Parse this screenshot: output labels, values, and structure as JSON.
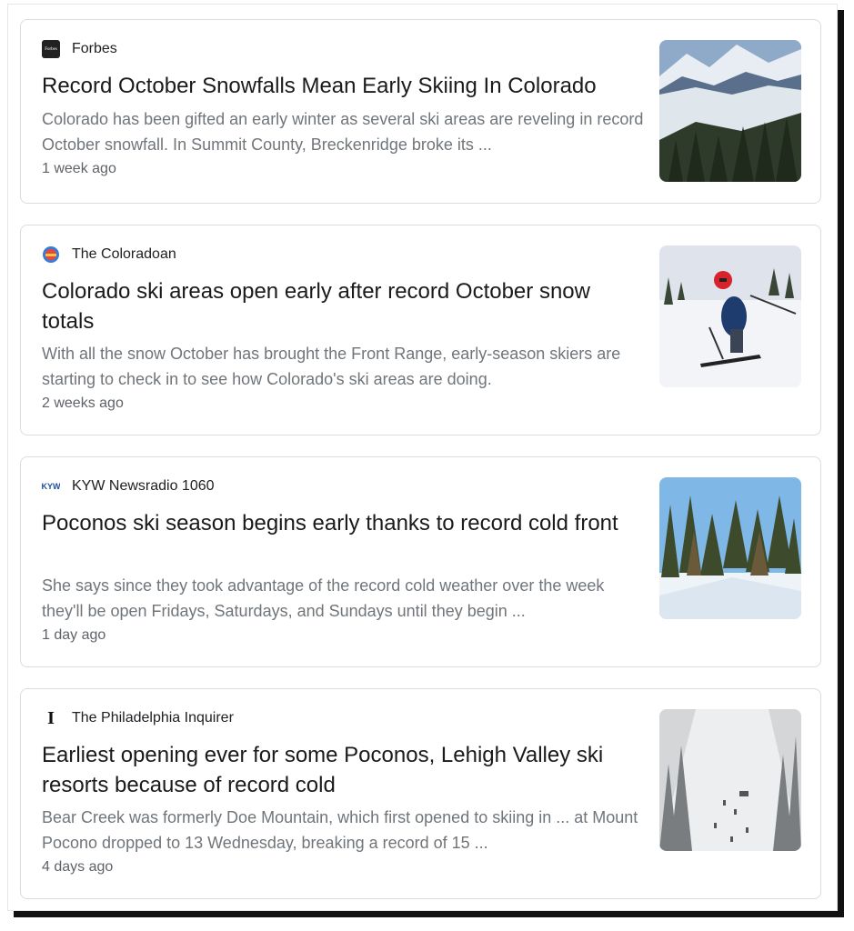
{
  "articles": [
    {
      "source": "Forbes",
      "favicon": "forbes-icon",
      "headline": "Record October Snowfalls Mean Early Skiing In Colorado",
      "snippet": "Colorado has been gifted an early winter as several ski areas are reveling in record October snowfall. In Summit County, Breckenridge broke its ...",
      "date": "1 week ago",
      "thumbnail": "snowy-mountain-forest-image"
    },
    {
      "source": "The Coloradoan",
      "favicon": "coloradoan-icon",
      "headline": "Colorado ski areas open early after record October snow totals",
      "snippet": "With all the snow October has brought the Front Range, early-season skiers are starting to check in to see how Colorado's ski areas are doing.",
      "date": "2 weeks ago",
      "thumbnail": "skier-red-helmet-image"
    },
    {
      "source": "KYW Newsradio 1060",
      "favicon": "kyw-icon",
      "headline": "Poconos ski season begins early thanks to record cold front",
      "snippet": "She says since they took advantage of the record cold weather over the week they'll be open Fridays, Saturdays, and Sundays until they begin ...",
      "date": "1 day ago",
      "thumbnail": "snowy-pine-trees-image"
    },
    {
      "source": "The Philadelphia Inquirer",
      "favicon": "inquirer-icon",
      "headline": "Earliest opening ever for some Poconos, Lehigh Valley ski resorts because of record cold",
      "snippet": "Bear Creek was formerly Doe Mountain, which first opened to skiing in ... at Mount Pocono dropped to 13 Wednesday, breaking a record of 15 ...",
      "date": "4 days ago",
      "thumbnail": "snowstorm-ski-slope-image"
    }
  ],
  "favicon_text": {
    "forbes": "Forbes",
    "kyw": "KYW",
    "inquirer": "I"
  },
  "colors": {
    "card_border": "#dadce0",
    "headline": "#1a1a1a",
    "snippet": "#70757a",
    "date": "#5f6368"
  }
}
